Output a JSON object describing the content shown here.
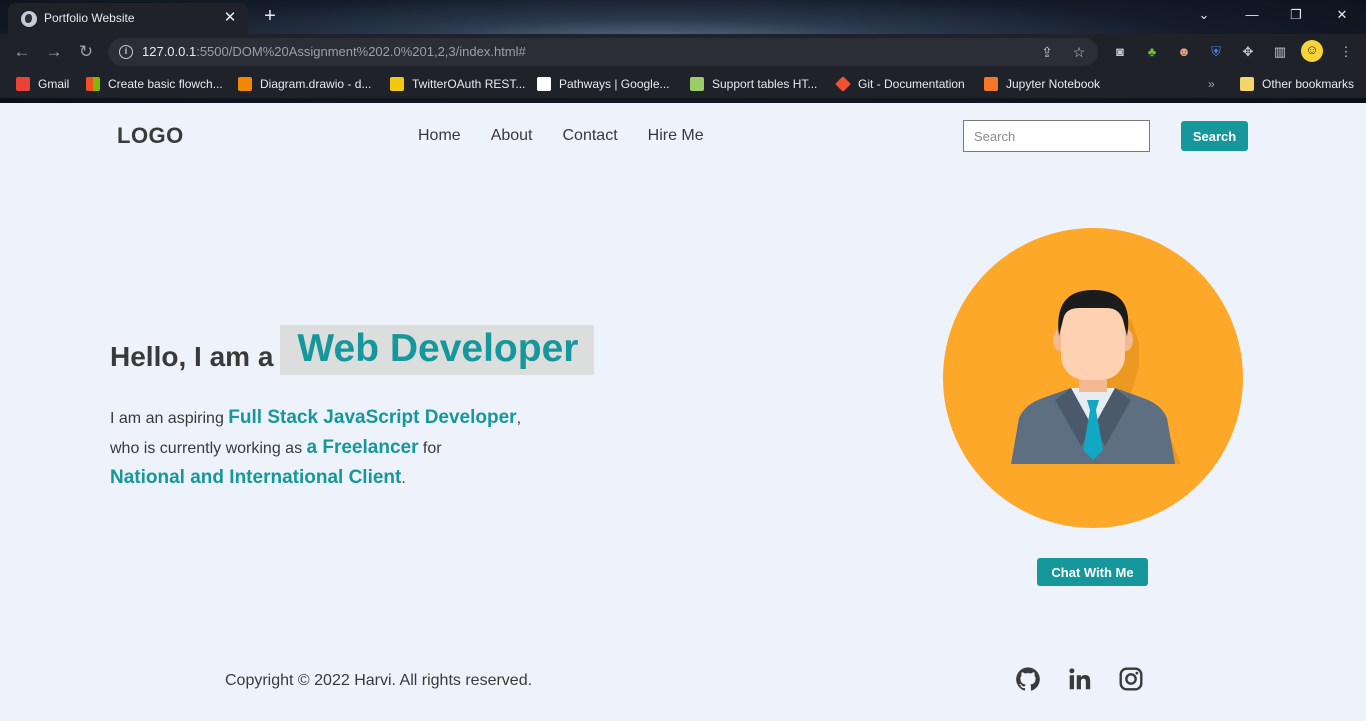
{
  "browser": {
    "tab_title": "Portfolio Website",
    "tab_close": "✕",
    "new_tab": "+",
    "url_host": "127.0.0.1",
    "url_path": ":5500/DOM%20Assignment%202.0%201,2,3/index.html#",
    "info_glyph": "i",
    "bookmarks": [
      {
        "label": "Gmail",
        "color": "#ea4335"
      },
      {
        "label": "Create basic flowch...",
        "color": "#f25022"
      },
      {
        "label": "Diagram.drawio - d...",
        "color": "#f08705"
      },
      {
        "label": "TwitterOAuth REST...",
        "color": "#f2c811"
      },
      {
        "label": "Pathways | Google...",
        "color": "#ffffff"
      },
      {
        "label": "Support tables HT...",
        "color": "#9ccc65"
      },
      {
        "label": "Git - Documentation",
        "color": "#f05133"
      },
      {
        "label": "Jupyter Notebook",
        "color": "#f37726"
      }
    ],
    "other_bookmarks": "Other bookmarks",
    "overflow": "»"
  },
  "header": {
    "logo": "LOGO",
    "nav": [
      "Home",
      "About",
      "Contact",
      "Hire Me"
    ],
    "search_placeholder": "Search",
    "search_button": "Search"
  },
  "hero": {
    "hello_prefix": "Hello, I am a",
    "role": "Web Developer",
    "intro": {
      "t1": "I am an aspiring ",
      "h1": "Full Stack JavaScript Developer",
      "t2": ",",
      "t3": "who is currently working as ",
      "h2": "a Freelancer",
      "t4": " for",
      "h3": "National and International Client",
      "t5": "."
    },
    "chat_button": "Chat With Me"
  },
  "footer": {
    "copyright": "Copyright © 2022 Harvi. All rights reserved.",
    "social_icons": [
      "github-icon",
      "linkedin-icon",
      "instagram-icon"
    ]
  },
  "colors": {
    "accent": "#16979b",
    "avatar_bg": "#fea829",
    "page_bg": "#eef2fb",
    "text": "#3a3a3a"
  }
}
